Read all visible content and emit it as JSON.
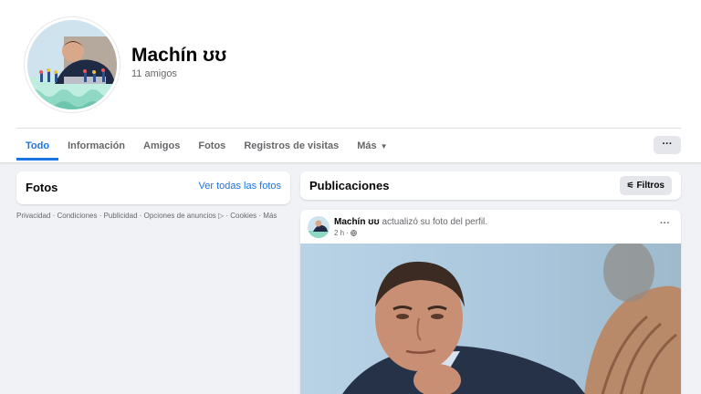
{
  "profile": {
    "name": "Machín ʊʊ",
    "friends_count": "11 amigos"
  },
  "tabs": [
    {
      "label": "Todo"
    },
    {
      "label": "Información"
    },
    {
      "label": "Amigos"
    },
    {
      "label": "Fotos"
    },
    {
      "label": "Registros de visitas"
    },
    {
      "label": "Más"
    }
  ],
  "header_more": "···",
  "photos_card": {
    "title": "Fotos",
    "see_all": "Ver todas las fotos"
  },
  "footer": {
    "links": "Privacidad · Condiciones · Publicidad · Opciones de anuncios ▷ · Cookies · Más"
  },
  "publications": {
    "title": "Publicaciones",
    "filter_label": "Filtros"
  },
  "post": {
    "author": "Machín ʊʊ",
    "action": "actualizó su foto del perfil.",
    "time": "2 h",
    "audience_icon": "globe-icon",
    "menu": "···"
  },
  "colors": {
    "accent": "#1b74e4",
    "background": "#f0f2f5",
    "secondary_text": "#65676b"
  }
}
